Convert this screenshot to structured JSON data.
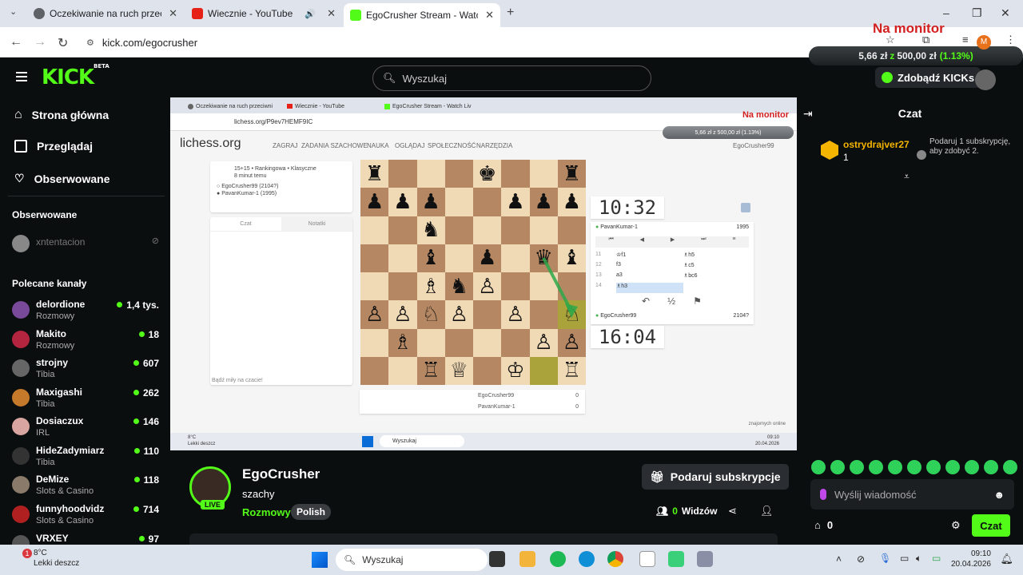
{
  "browser": {
    "tabs": [
      {
        "title": "Oczekiwanie na ruch przeciwni",
        "color": "#5f6368"
      },
      {
        "title": "Wiecznie - YouTube",
        "color": "#e62117"
      },
      {
        "title": "EgoCrusher Stream - Watch Liv",
        "color": "#53fc18"
      }
    ],
    "url": "kick.com/egocrusher"
  },
  "overlay": {
    "title": "Na monitor",
    "raised": "5,66 zł",
    "separator": "z",
    "goal": "500,00 zł",
    "percent": "(1.13%)",
    "profile_initial": "M"
  },
  "header": {
    "logo": "KICK",
    "logo_badge": "BETA",
    "search_placeholder": "Wyszukaj",
    "get_kicks": "Zdobądź KICKs"
  },
  "sidebar": {
    "nav": [
      {
        "label": "Strona główna",
        "icon": "home-icon"
      },
      {
        "label": "Przeglądaj",
        "icon": "browse-icon"
      },
      {
        "label": "Obserwowane",
        "icon": "heart-icon"
      }
    ],
    "followed_heading": "Obserwowane",
    "followed": [
      {
        "name": "xntentacion"
      }
    ],
    "recommended_heading": "Polecane kanały",
    "channels": [
      {
        "name": "delordione",
        "category": "Rozmowy",
        "viewers": "1,4 tys.",
        "color": "#7a4a9a"
      },
      {
        "name": "Makito",
        "category": "Rozmowy",
        "viewers": "18",
        "color": "#b3243e"
      },
      {
        "name": "strojny",
        "category": "Tibia",
        "viewers": "607",
        "color": "#666"
      },
      {
        "name": "Maxigashi",
        "category": "Tibia",
        "viewers": "262",
        "color": "#c47a2a"
      },
      {
        "name": "Dosiaczux",
        "category": "IRL",
        "viewers": "146",
        "color": "#d9a5a0"
      },
      {
        "name": "HideZadymiarz",
        "category": "Tibia",
        "viewers": "110",
        "color": "#333"
      },
      {
        "name": "DeMize",
        "category": "Slots & Casino",
        "viewers": "118",
        "color": "#8a7a6a"
      },
      {
        "name": "funnyhoodvidz",
        "category": "Slots & Casino",
        "viewers": "714",
        "color": "#b02020"
      },
      {
        "name": "VRXEY",
        "category": "",
        "viewers": "97",
        "color": "#555"
      }
    ]
  },
  "stream": {
    "inner_tabs": [
      "Oczekiwanie na ruch przeciwni",
      "Wiecznie - YouTube",
      "EgoCrusher Stream - Watch Liv"
    ],
    "inner_url": "lichess.org/P9ev7HEMF9IC",
    "inner_monitor": "Na monitor",
    "inner_goal": "5,66 zł z 500,00 zł (1.13%)",
    "lichess_logo": "lichess.org",
    "lichess_nav": [
      "ZAGRAJ",
      "ZADANIA SZACHOWE",
      "NAUKA",
      "OGLĄDAJ",
      "SPOŁECZNOŚĆ",
      "NARZĘDZIA"
    ],
    "lichess_user": "EgoCrusher99",
    "game_type": "15+15 • Rankingowa • Klasyczne",
    "game_time": "8 minut temu",
    "player_white": "EgoCrusher99 (2104?)",
    "player_black": "PavanKumar-1 (1995)",
    "chat_tab": "Czat",
    "notes_tab": "Notatki",
    "chat_placeholder": "Bądź miły na czacie!",
    "clock_top": "10:32",
    "clock_bottom": "16:04",
    "top_player": "PavanKumar-1",
    "top_rating": "1995",
    "bottom_player": "EgoCrusher99",
    "bottom_rating": "2104?",
    "moves": [
      {
        "n": "11",
        "w": "♔f1",
        "b": "♗h5"
      },
      {
        "n": "12",
        "w": "f3",
        "b": "♗c5"
      },
      {
        "n": "13",
        "w": "a3",
        "b": "♗bc6"
      },
      {
        "n": "14",
        "w": "♗h3",
        "b": ""
      }
    ],
    "score_white": "EgoCrusher99",
    "score_white_val": "0",
    "score_black": "PavanKumar-1",
    "score_black_val": "0",
    "online_note": "znajomych online",
    "in_taskbar_search": "Wyszukaj",
    "in_weather_temp": "8°C",
    "in_weather_desc": "Lekki deszcz",
    "in_time": "09:10",
    "in_date": "20.04.2026",
    "board": [
      [
        "♜",
        "",
        "",
        "",
        "♚",
        "",
        "",
        "♜"
      ],
      [
        "♟",
        "♟",
        "♟",
        "",
        "",
        "♟",
        "♟",
        "♟"
      ],
      [
        "",
        "",
        "♞",
        "",
        "",
        "",
        "",
        ""
      ],
      [
        "",
        "",
        "♝",
        "",
        "♟",
        "",
        "♛",
        "♝"
      ],
      [
        "",
        "",
        "♗",
        "♞",
        "♙",
        "",
        "",
        ""
      ],
      [
        "♙",
        "♙",
        "♘",
        "♙",
        "",
        "♙",
        "",
        "♘"
      ],
      [
        "",
        "♗",
        "",
        "",
        "",
        "",
        "♙",
        "♙"
      ],
      [
        "",
        "",
        "♖",
        "♕",
        "",
        "♔",
        "",
        "♖"
      ]
    ]
  },
  "chat": {
    "title": "Czat",
    "pinned_user": "ostrydrajver27",
    "pinned_count": "1",
    "pinned_text": "Podaruj 1 subskrypcję, aby zdobyć 2.",
    "input_placeholder": "Wyślij wiadomość",
    "kicks_count": "0",
    "send_label": "Czat"
  },
  "streamer": {
    "name": "EgoCrusher",
    "title": "szachy",
    "category": "Rozmowy",
    "tag": "Polish",
    "live": "LIVE",
    "gift_sub": "Podaruj subskrypcje",
    "viewers_count": "0",
    "viewers_label": "Widzów"
  },
  "taskbar": {
    "weather_temp": "8°C",
    "weather_desc": "Lekki deszcz",
    "weather_badge": "1",
    "search": "Wyszukaj",
    "time": "09:10",
    "date": "20.04.2026"
  }
}
